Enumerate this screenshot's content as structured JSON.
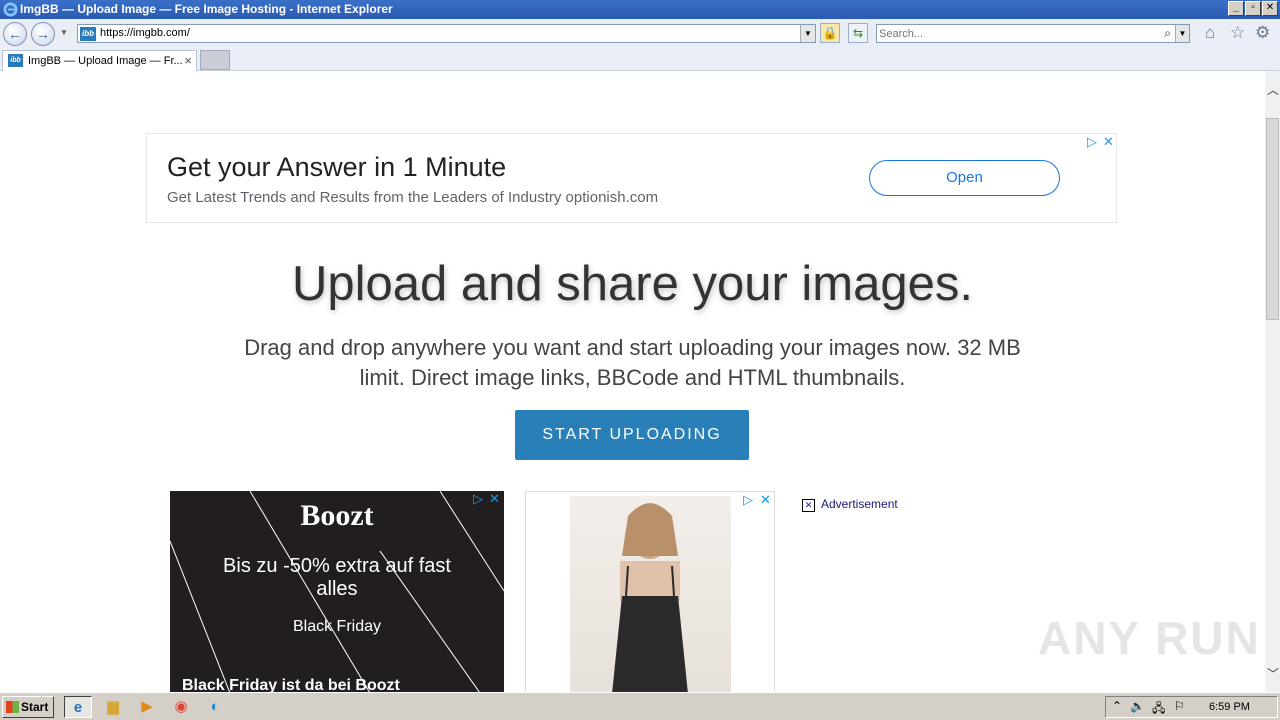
{
  "window": {
    "title": "ImgBB — Upload Image — Free Image Hosting - Internet Explorer",
    "minimize": "_",
    "restore": "▫",
    "close": "✕"
  },
  "navbar": {
    "url": "https://imgbb.com/",
    "favicon_text": "ibb",
    "search_placeholder": "Search..."
  },
  "tab": {
    "title": "ImgBB — Upload Image — Fr...",
    "close": "×"
  },
  "ad_banner": {
    "headline": "Get your Answer in 1 Minute",
    "description": "Get Latest Trends and Results from the Leaders of Industry optionish.com",
    "button": "Open"
  },
  "hero": {
    "title": "Upload and share your images.",
    "subtitle": "Drag and drop anywhere you want and start uploading your images now. 32 MB limit. Direct image links, BBCode and HTML thumbnails.",
    "button": "START UPLOADING"
  },
  "ad_boozt": {
    "brand": "Boozt",
    "offer": "Bis zu -50% extra auf fast alles",
    "event": "Black Friday",
    "footer": "Black Friday ist da bei Boozt"
  },
  "ad_label": "Advertisement",
  "watermark": "ANY RUN",
  "taskbar": {
    "start": "Start",
    "clock": "6:59 PM"
  }
}
